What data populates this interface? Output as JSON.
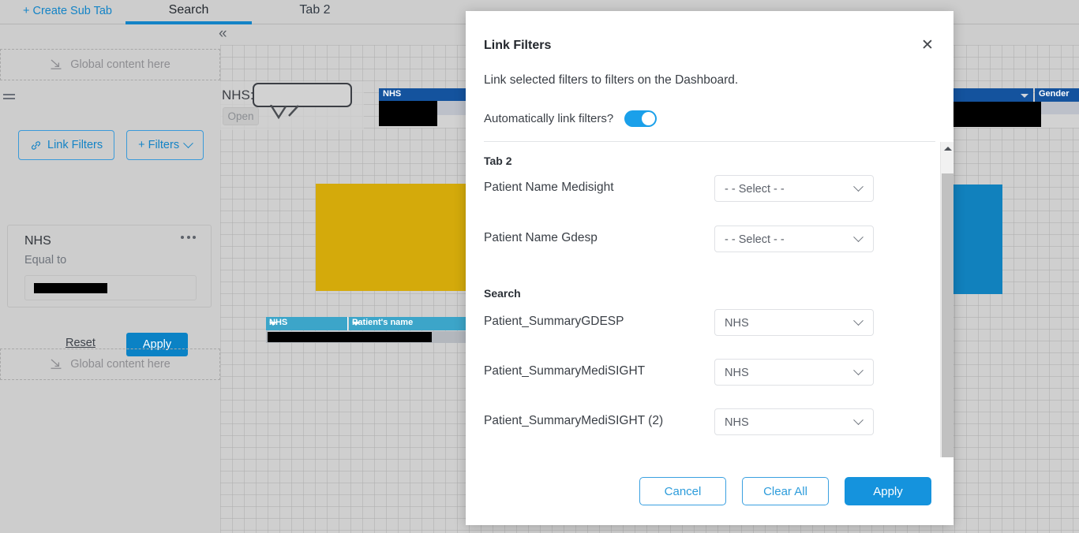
{
  "tabbar": {
    "create_sub_tab": "+ Create Sub Tab",
    "tabs": [
      {
        "label": "Search",
        "active": true
      },
      {
        "label": "Tab 2",
        "active": false
      }
    ],
    "collapse_icon": "«"
  },
  "left_panel": {
    "dropzone_top_label": "Global content here",
    "dropzone_bottom_label": "Global content here",
    "link_filters_button": "Link Filters",
    "add_filters_button": "+ Filters",
    "filter_card": {
      "title": "NHS",
      "operator": "Equal to",
      "value": ""
    },
    "reset_link": "Reset",
    "apply_button": "Apply"
  },
  "canvas": {
    "nhs_search": {
      "label": "NHS:",
      "value": "",
      "open_button": "Open"
    },
    "table_left": {
      "header": "NHS"
    },
    "table_right": {
      "header_gender": "Gender"
    },
    "data_table": {
      "columns": [
        "NHS",
        "Patient's name"
      ]
    }
  },
  "modal": {
    "title": "Link Filters",
    "description": "Link selected filters to filters on the Dashboard.",
    "auto_link_label": "Automatically link filters?",
    "auto_link_on": true,
    "close_icon": "✕",
    "groups": [
      {
        "name": "Tab 2",
        "rows": [
          {
            "label": "Patient Name Medisight",
            "value": "- - Select - -"
          },
          {
            "label": "Patient Name Gdesp",
            "value": "- - Select - -"
          }
        ]
      },
      {
        "name": "Search",
        "rows": [
          {
            "label": "Patient_SummaryGDESP",
            "value": "NHS"
          },
          {
            "label": "Patient_SummaryMediSIGHT",
            "value": "NHS"
          },
          {
            "label": "Patient_SummaryMediSIGHT (2)",
            "value": "NHS"
          }
        ]
      }
    ],
    "footer": {
      "cancel": "Cancel",
      "clear_all": "Clear All",
      "apply": "Apply"
    }
  },
  "colors": {
    "accent_blue": "#1383c6",
    "primary_button": "#1593dd",
    "toggle_on": "#1aa0ea",
    "tab_underline": "#1383c6",
    "canvas_bg": "#cfcfcf",
    "panel_bg": "#cdcdcd",
    "widget_yellow": "#d4aa0b",
    "widget_blue": "#1181bd",
    "table_header_blue": "#14539e",
    "table_header_teal": "#3ca5c9"
  }
}
